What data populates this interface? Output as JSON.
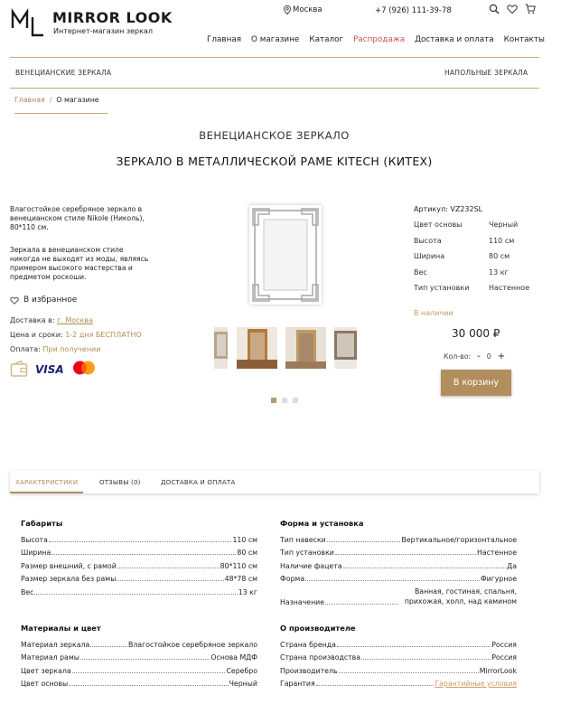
{
  "brand": {
    "logo": "ML",
    "name": "MIRROR LOOK",
    "tagline": "Интернет-магазин зеркал"
  },
  "header": {
    "city": "Москва",
    "phone": "+7 (926) 111-39-78",
    "icons": [
      "search-icon",
      "heart-icon",
      "cart-icon"
    ]
  },
  "nav": [
    {
      "label": "Главная"
    },
    {
      "label": "О магазине"
    },
    {
      "label": "Каталог"
    },
    {
      "label": "Распродажа",
      "active": true
    },
    {
      "label": "Доставка и оплата"
    },
    {
      "label": "Контакты"
    }
  ],
  "subnav": {
    "left": "ВЕНЕЦИАНСКИЕ ЗЕРКАЛА",
    "right": "НАПОЛЬНЫЕ ЗЕРКАЛА"
  },
  "breadcrumb": {
    "home": "Главная",
    "sep": "/",
    "current": "О магазине"
  },
  "product": {
    "category": "ВЕНЕЦИАНСКОЕ ЗЕРКАЛО",
    "title": "ЗЕРКАЛО В МЕТАЛЛИЧЕСКОЙ РАМЕ KITECH (КИТЕХ)",
    "desc1": "Влагостойкое серебряное зеркало в венецианском стиле Nikole (Николь), 80*110 см.",
    "desc2": "Зеркала в венецианском стиле никогда не выходят из моды, являясь примером высокого мастерства и предметом роскоши.",
    "favorite": "В избранное",
    "delivery_label": "Доставка в:",
    "delivery_city": "г. Москва",
    "terms_label": "Цена и сроки:",
    "terms_value": "1-2 дня БЕСПЛАТНО",
    "payment_label": "Оплата:",
    "payment_value": "При получении",
    "payment_icons": [
      "wallet-icon",
      "visa-logo",
      "mastercard-logo"
    ],
    "gallery_dots": 3,
    "gallery_active_dot": 1,
    "sku_label": "Артикул:",
    "sku": "VZ232SL",
    "specs": [
      {
        "k": "Цвет основы",
        "v": "Черный"
      },
      {
        "k": "Высота",
        "v": "110 см"
      },
      {
        "k": "Ширина",
        "v": "80 см"
      },
      {
        "k": "Вес",
        "v": "13 кг"
      },
      {
        "k": "Тип установки",
        "v": "Настенное"
      }
    ],
    "stock": "В наличии",
    "price": "30 000 ₽",
    "qty_label": "Кол-во:",
    "qty_minus": "-",
    "qty_value": "0",
    "qty_plus": "+",
    "cart_button": "В корзину"
  },
  "tabs": [
    {
      "label": "ХАРАКТЕРИСТИКИ",
      "active": true
    },
    {
      "label": "ОТЗЫВЫ (0)"
    },
    {
      "label": "ДОСТАВКА И ОПЛАТА"
    }
  ],
  "characteristics": {
    "dims": {
      "title": "Габариты",
      "rows": [
        {
          "k": "Высота",
          "v": "110 см"
        },
        {
          "k": "Ширина",
          "v": "80 см"
        },
        {
          "k": "Размер внешний, с рамой",
          "v": "80*110 см"
        },
        {
          "k": "Размер зеркала без рамы",
          "v": "48*78 см"
        },
        {
          "k": "Вес",
          "v": "13 кг"
        }
      ]
    },
    "mount": {
      "title": "Форма и установка",
      "rows": [
        {
          "k": "Тип навески",
          "v": "Вертикальное/горизонтальное"
        },
        {
          "k": "Тип установки",
          "v": "Настенное"
        },
        {
          "k": "Наличие фацета",
          "v": "Да"
        },
        {
          "k": "Форма",
          "v": "Фигурное"
        },
        {
          "k": "Назначение",
          "v": "Ванная, гостиная, спальня, прихожая, холл, над камином"
        }
      ]
    },
    "materials": {
      "title": "Материалы и цвет",
      "rows": [
        {
          "k": "Материал зеркала",
          "v": "Влагостойкое серебряное зеркало"
        },
        {
          "k": "Материал рамы",
          "v": "Основа МДФ"
        },
        {
          "k": "Цвет зеркала",
          "v": "Серебро"
        },
        {
          "k": "Цвет основы",
          "v": "Черный"
        }
      ]
    },
    "maker": {
      "title": "О производителе",
      "rows": [
        {
          "k": "Страна бренда",
          "v": "Россия"
        },
        {
          "k": "Страна производства",
          "v": "Россия"
        },
        {
          "k": "Производитель",
          "v": "MirrorLook"
        },
        {
          "k": "Гарантия",
          "v": "Гарантийные условия"
        }
      ]
    }
  },
  "colors": {
    "accent": "#b28e5e",
    "nav_active": "#c9574a",
    "rule": "#c7a97c"
  }
}
